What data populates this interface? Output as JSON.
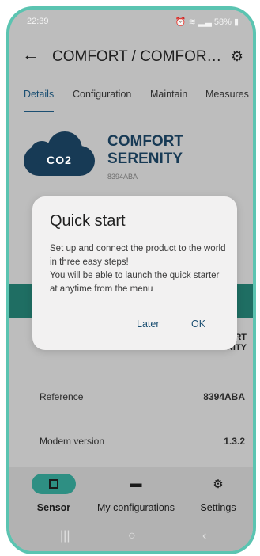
{
  "status_bar": {
    "time": "22:39",
    "battery": "58%",
    "icons": [
      "alarm-icon",
      "wifi-icon",
      "signal-icon"
    ]
  },
  "header": {
    "title": "COMFORT / COMFORT...",
    "back_icon": "back-arrow-icon",
    "settings_icon": "gear-plus-icon"
  },
  "tabs": [
    {
      "label": "Details",
      "active": true
    },
    {
      "label": "Configuration",
      "active": false
    },
    {
      "label": "Maintain",
      "active": false
    },
    {
      "label": "Measures",
      "active": false
    }
  ],
  "product": {
    "icon_text": "CO2",
    "name_line1": "COMFORT",
    "name_line2": "SERENITY",
    "reference": "8394ABA"
  },
  "behind_dialog": {
    "line1": "RT",
    "line2": "NITY"
  },
  "info_rows": [
    {
      "label": "Reference",
      "value": "8394ABA"
    },
    {
      "label": "Modem version",
      "value": "1.3.2"
    }
  ],
  "bottom_nav": [
    {
      "label": "Sensor",
      "icon": "sensor-icon",
      "active": true
    },
    {
      "label": "My configurations",
      "icon": "folder-icon",
      "active": false
    },
    {
      "label": "Settings",
      "icon": "gear-icon",
      "active": false
    }
  ],
  "system_nav": {
    "recents": "|||",
    "home": "○",
    "back": "‹"
  },
  "dialog": {
    "title": "Quick start",
    "body_line1": "Set up and connect the product to the world in three easy steps!",
    "body_line2": "You will be able to launch the quick starter at anytime from the menu",
    "later_label": "Later",
    "ok_label": "OK"
  },
  "colors": {
    "accent": "#1b4f72",
    "teal": "#1f6e63",
    "frame": "#5bc4b1",
    "dark_navy": "#173a55"
  }
}
